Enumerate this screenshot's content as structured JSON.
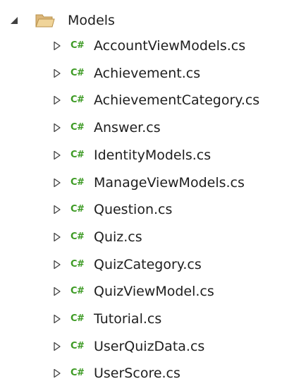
{
  "solution_explorer": {
    "folder": {
      "label": "Models",
      "expanded": true,
      "icon": "folder-open-icon"
    },
    "file_icon_text": "C#",
    "file_icon_color": "#3c9a23",
    "files": [
      {
        "label": "AccountViewModels.cs"
      },
      {
        "label": "Achievement.cs"
      },
      {
        "label": "AchievementCategory.cs"
      },
      {
        "label": "Answer.cs"
      },
      {
        "label": "IdentityModels.cs"
      },
      {
        "label": "ManageViewModels.cs"
      },
      {
        "label": "Question.cs"
      },
      {
        "label": "Quiz.cs"
      },
      {
        "label": "QuizCategory.cs"
      },
      {
        "label": "QuizViewModel.cs"
      },
      {
        "label": "Tutorial.cs"
      },
      {
        "label": "UserQuizData.cs"
      },
      {
        "label": "UserScore.cs"
      }
    ]
  }
}
